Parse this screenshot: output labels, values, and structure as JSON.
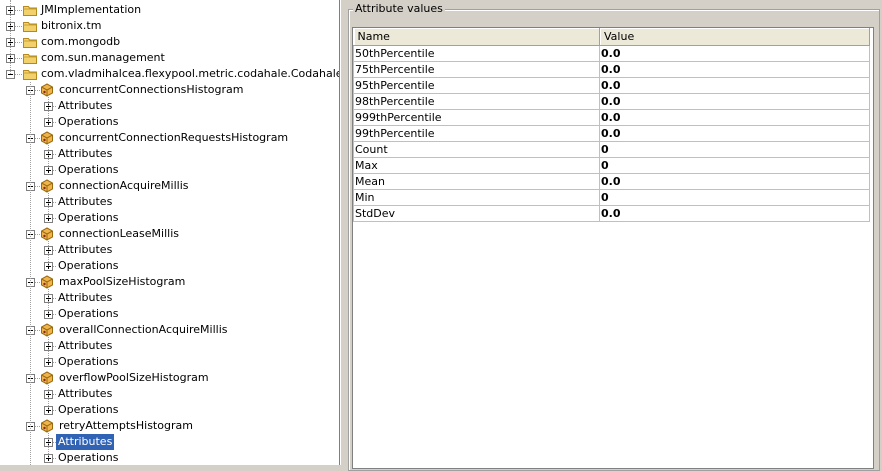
{
  "tree": {
    "roots": [
      {
        "label": "JMImplementation",
        "expanded": false
      },
      {
        "label": "bitronix.tm",
        "expanded": false
      },
      {
        "label": "com.mongodb",
        "expanded": false
      },
      {
        "label": "com.sun.management",
        "expanded": false
      },
      {
        "label": "com.vladmihalcea.flexypool.metric.codahale.CodahaleMetrics.",
        "expanded": true
      }
    ],
    "metrics": [
      {
        "label": "concurrentConnectionsHistogram",
        "children": [
          "Attributes",
          "Operations"
        ]
      },
      {
        "label": "concurrentConnectionRequestsHistogram",
        "children": [
          "Attributes",
          "Operations"
        ]
      },
      {
        "label": "connectionAcquireMillis",
        "children": [
          "Attributes",
          "Operations"
        ]
      },
      {
        "label": "connectionLeaseMillis",
        "children": [
          "Attributes",
          "Operations"
        ]
      },
      {
        "label": "maxPoolSizeHistogram",
        "children": [
          "Attributes",
          "Operations"
        ]
      },
      {
        "label": "overallConnectionAcquireMillis",
        "children": [
          "Attributes",
          "Operations"
        ]
      },
      {
        "label": "overflowPoolSizeHistogram",
        "children": [
          "Attributes",
          "Operations"
        ]
      },
      {
        "label": "retryAttemptsHistogram",
        "children": [
          "Attributes",
          "Operations"
        ]
      }
    ],
    "selected": {
      "metric_index": 7,
      "child": "Attributes"
    }
  },
  "attributes": {
    "title": "Attribute values",
    "columns": [
      "Name",
      "Value"
    ],
    "rows": [
      {
        "name": "50thPercentile",
        "value": "0.0"
      },
      {
        "name": "75thPercentile",
        "value": "0.0"
      },
      {
        "name": "95thPercentile",
        "value": "0.0"
      },
      {
        "name": "98thPercentile",
        "value": "0.0"
      },
      {
        "name": "999thPercentile",
        "value": "0.0"
      },
      {
        "name": "99thPercentile",
        "value": "0.0"
      },
      {
        "name": "Count",
        "value": "0"
      },
      {
        "name": "Max",
        "value": "0"
      },
      {
        "name": "Mean",
        "value": "0.0"
      },
      {
        "name": "Min",
        "value": "0"
      },
      {
        "name": "StdDev",
        "value": "0.0"
      }
    ]
  },
  "colors": {
    "selection": "#3163b5",
    "folder": "#e8c34a",
    "bean": "#e8a53a"
  },
  "icons": {
    "folder": "folder-icon",
    "bean": "mbean-icon",
    "expander": "expand-collapse-icon"
  }
}
